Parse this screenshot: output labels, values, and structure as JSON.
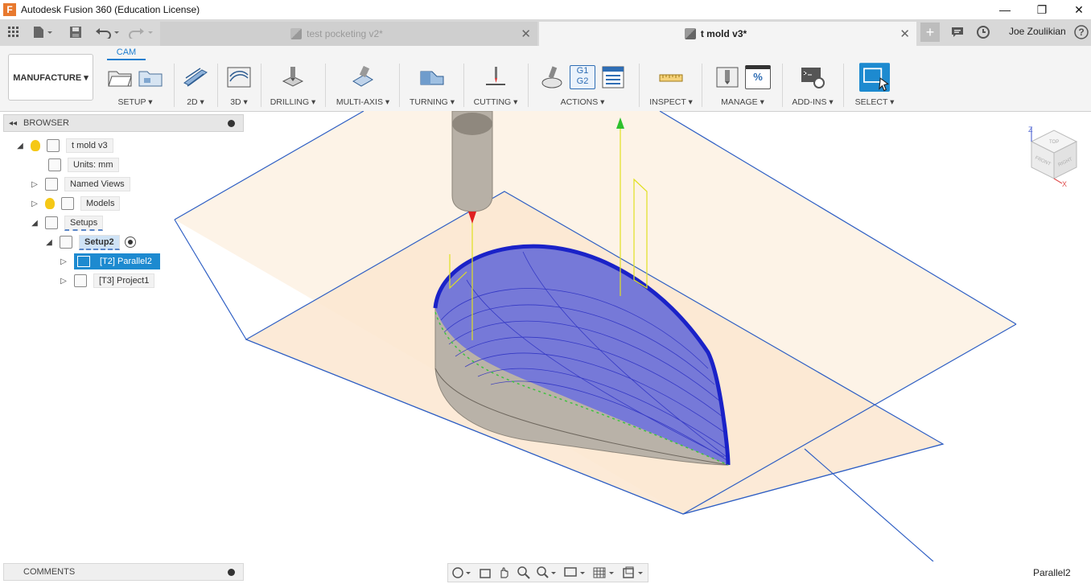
{
  "window": {
    "title": "Autodesk Fusion 360 (Education License)",
    "logo_letter": "F",
    "minimize": "—",
    "maximize": "❐",
    "close": "✕"
  },
  "tabs": [
    {
      "label": "test pocketing v2*",
      "close": "✕"
    },
    {
      "label": "t mold v3*",
      "close": "✕"
    }
  ],
  "toolbar_top": {
    "user_name": "Joe Zoulikian",
    "new_tab": "+",
    "help": "?"
  },
  "ribbon": {
    "workspace": "MANUFACTURE ▾",
    "active_tab": "CAM",
    "groups": [
      {
        "label": "SETUP ▾"
      },
      {
        "label": "2D ▾"
      },
      {
        "label": "3D ▾"
      },
      {
        "label": "DRILLING ▾"
      },
      {
        "label": "MULTI-AXIS ▾"
      },
      {
        "label": "TURNING ▾"
      },
      {
        "label": "CUTTING ▾"
      },
      {
        "label": "ACTIONS ▾"
      },
      {
        "label": "INSPECT ▾"
      },
      {
        "label": "MANAGE ▾"
      },
      {
        "label": "ADD-INS ▾"
      },
      {
        "label": "SELECT ▾"
      }
    ],
    "actions_g1": "G1",
    "actions_g2": "G2",
    "manage_percent": "%"
  },
  "browser": {
    "title": "BROWSER",
    "collapse": "◂◂",
    "tree": [
      {
        "label": "t mold v3"
      },
      {
        "label": "Units: mm"
      },
      {
        "label": "Named Views"
      },
      {
        "label": "Models"
      },
      {
        "label": "Setups"
      },
      {
        "label": "Setup2"
      },
      {
        "label": "[T2] Parallel2"
      },
      {
        "label": "[T3] Project1"
      }
    ]
  },
  "comments": {
    "label": "COMMENTS"
  },
  "status": {
    "selection": "Parallel2"
  },
  "viewcube": {
    "top": "TOP",
    "front": "FRONT",
    "right": "RIGHT",
    "z": "Z",
    "x": "X"
  }
}
